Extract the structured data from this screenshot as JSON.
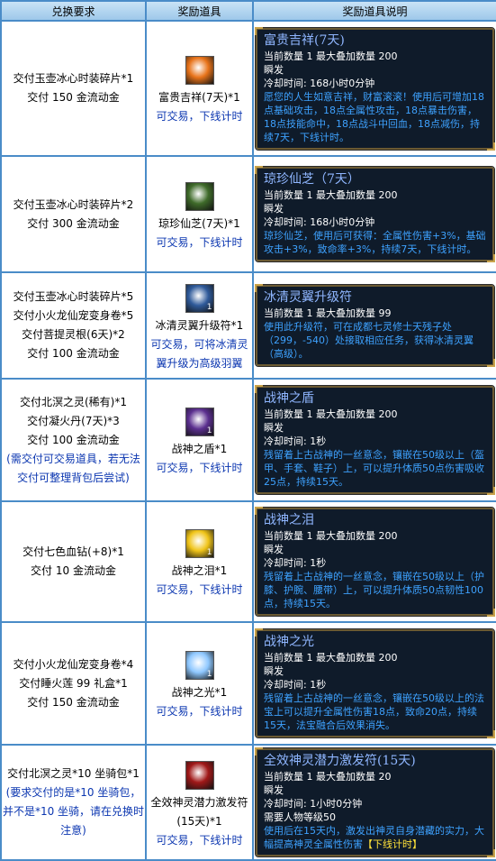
{
  "headers": {
    "col1": "兑换要求",
    "col2": "奖励道具",
    "col3": "奖励道具说明"
  },
  "rows": [
    {
      "req": [
        "交付玉壶冰心时装碎片*1",
        "交付 150 金流动金"
      ],
      "req_note": "",
      "icon": "fortune-charm-icon",
      "icon_color": "#e8731a",
      "icon_count": "",
      "item_name": "富贵吉祥(7天)*1",
      "trade": "可交易，下线计时",
      "card_title": "富贵吉祥(7天)",
      "card_lines": [
        "当前数量 1 最大叠加数量 200",
        "瞬发",
        "冷却时间:  168小时0分钟"
      ],
      "card_desc": "愿您的人生如意吉祥，财富滚滚！使用后可增加18点基础攻击，18点全属性攻击，18点暴击伤害，18点技能命中，18点战斗中回血，18点减伤，持续7天，下线计时。",
      "card_extra": ""
    },
    {
      "req": [
        "交付玉壶冰心时装碎片*2",
        "交付 300 金流动金"
      ],
      "req_note": "",
      "icon": "ganoderma-icon",
      "icon_color": "#3f6b2a",
      "icon_count": "",
      "item_name": "琼珍仙芝(7天)*1",
      "trade": "可交易，下线计时",
      "card_title": "琼珍仙芝（7天）",
      "card_lines": [
        "当前数量 1 最大叠加数量 200",
        "瞬发",
        "冷却时间:  168小时0分钟"
      ],
      "card_desc": "琼珍仙芝，使用后可获得：全属性伤害+3%，基础攻击+3%，致命率+3%，持续7天，下线计时。",
      "card_extra": ""
    },
    {
      "req": [
        "交付玉壶冰心时装碎片*5",
        "交付小火龙仙宠变身卷*5",
        "交付菩提灵根(6天)*2",
        "交付 100 金流动金"
      ],
      "req_note": "",
      "icon": "wing-upgrade-icon",
      "icon_color": "#2f5a9a",
      "icon_count": "1",
      "item_name": "冰清灵翼升级符*1",
      "trade": "可交易，可将冰清灵翼升级为高级羽翼",
      "card_title": "冰清灵翼升级符",
      "card_lines": [
        "当前数量 1 最大叠加数量 99"
      ],
      "card_desc": "使用此升级符，可在成都七灵修士天残子处（299，-540）处接取相应任务，获得冰清灵翼（高级）。",
      "card_extra": ""
    },
    {
      "req": [
        "交付北溟之灵(稀有)*1",
        "交付凝火丹(7天)*3",
        "交付 100 金流动金"
      ],
      "req_note": "(需交付可交易道具，若无法交付可整理背包后尝试)",
      "icon": "war-god-shield-icon",
      "icon_color": "#5b2f8f",
      "icon_count": "1",
      "item_name": "战神之盾*1",
      "trade": "可交易，下线计时",
      "card_title": "战神之盾",
      "card_lines": [
        "当前数量 1 最大叠加数量 200",
        "瞬发",
        "冷却时间:  1秒"
      ],
      "card_desc": "残留着上古战神的一丝意念，镶嵌在50级以上（盔甲、手套、鞋子）上，可以提升体质50点伤害吸收25点，持续15天。",
      "card_extra": ""
    },
    {
      "req": [
        "交付七色血钻(+8)*1",
        "交付 10 金流动金"
      ],
      "req_note": "",
      "icon": "war-god-tear-icon",
      "icon_color": "#f0c419",
      "icon_count": "1",
      "item_name": "战神之泪*1",
      "trade": "可交易，下线计时",
      "card_title": "战神之泪",
      "card_lines": [
        "当前数量 1 最大叠加数量 200",
        "瞬发",
        "冷却时间:  1秒"
      ],
      "card_desc": "残留着上古战神的一丝意念，镶嵌在50级以上（护膝、护腕、腰带）上，可以提升体质50点韧性100点，持续15天。",
      "card_extra": ""
    },
    {
      "req": [
        "交付小火龙仙宠变身卷*4",
        "交付睡火莲 99 礼盒*1",
        "交付 150 金流动金"
      ],
      "req_note": "",
      "icon": "war-god-light-icon",
      "icon_color": "#8fc8ff",
      "icon_count": "1",
      "item_name": "战神之光*1",
      "trade": "可交易，下线计时",
      "card_title": "战神之光",
      "card_lines": [
        "当前数量 1 最大叠加数量 200",
        "瞬发",
        "冷却时间:  1秒"
      ],
      "card_desc": "残留着上古战神的一丝意念，镶嵌在50级以上的法宝上可以提升全属性伤害18点，致命20点，持续15天，法宝融合后效果消失。",
      "card_extra": ""
    },
    {
      "req": [
        "交付北溟之灵*10 坐骑包*1"
      ],
      "req_note": "(要求交付的是*10 坐骑包，并不是*10 坐骑，请在兑换时注意)",
      "icon": "potential-talisman-icon",
      "icon_color": "#a01818",
      "icon_count": "",
      "item_name": "全效神灵潜力激发符(15天)*1",
      "trade": "可交易，下线计时",
      "card_title": "全效神灵潜力激发符(15天)",
      "card_lines": [
        "当前数量 1 最大叠加数量 20",
        "瞬发",
        "冷却时间:  1小时0分钟",
        "需要人物等级50"
      ],
      "card_desc": "使用后在15天内，激发出神灵自身潜藏的实力，大幅提高神灵全属性伤害",
      "card_extra": "【下线计时】"
    }
  ]
}
